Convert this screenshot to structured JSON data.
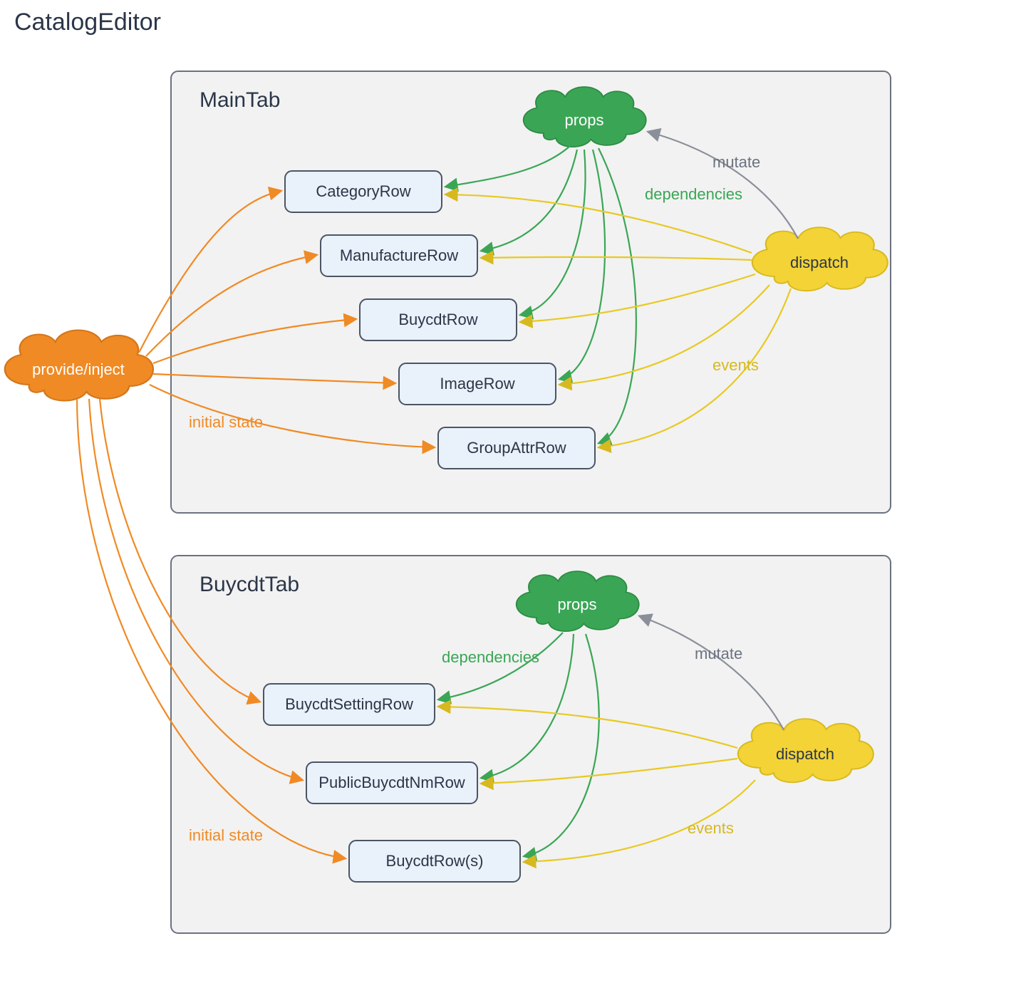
{
  "title": "CatalogEditor",
  "colors": {
    "orange": "#f08a24",
    "green": "#3aa655",
    "yellow": "#f3d335",
    "yellowStroke": "#d7b91f",
    "gray": "#8a8f99",
    "tabFill": "#f2f2f2",
    "rowFill": "#e9f1fb",
    "rowStroke": "#4b5563",
    "text": "#2b3648"
  },
  "provideInject": {
    "label": "provide/inject"
  },
  "edgeLabels": {
    "initialState": "initial state",
    "dependencies": "dependencies",
    "events": "events",
    "mutate": "mutate"
  },
  "tabs": [
    {
      "key": "main",
      "title": "MainTab",
      "props": {
        "label": "props"
      },
      "dispatch": {
        "label": "dispatch"
      },
      "rows": [
        {
          "label": "CategoryRow"
        },
        {
          "label": "ManufactureRow"
        },
        {
          "label": "BuycdtRow"
        },
        {
          "label": "ImageRow"
        },
        {
          "label": "GroupAttrRow"
        }
      ]
    },
    {
      "key": "buycdt",
      "title": "BuycdtTab",
      "props": {
        "label": "props"
      },
      "dispatch": {
        "label": "dispatch"
      },
      "rows": [
        {
          "label": "BuycdtSettingRow"
        },
        {
          "label": "PublicBuycdtNmRow"
        },
        {
          "label": "BuycdtRow(s)"
        }
      ]
    }
  ]
}
